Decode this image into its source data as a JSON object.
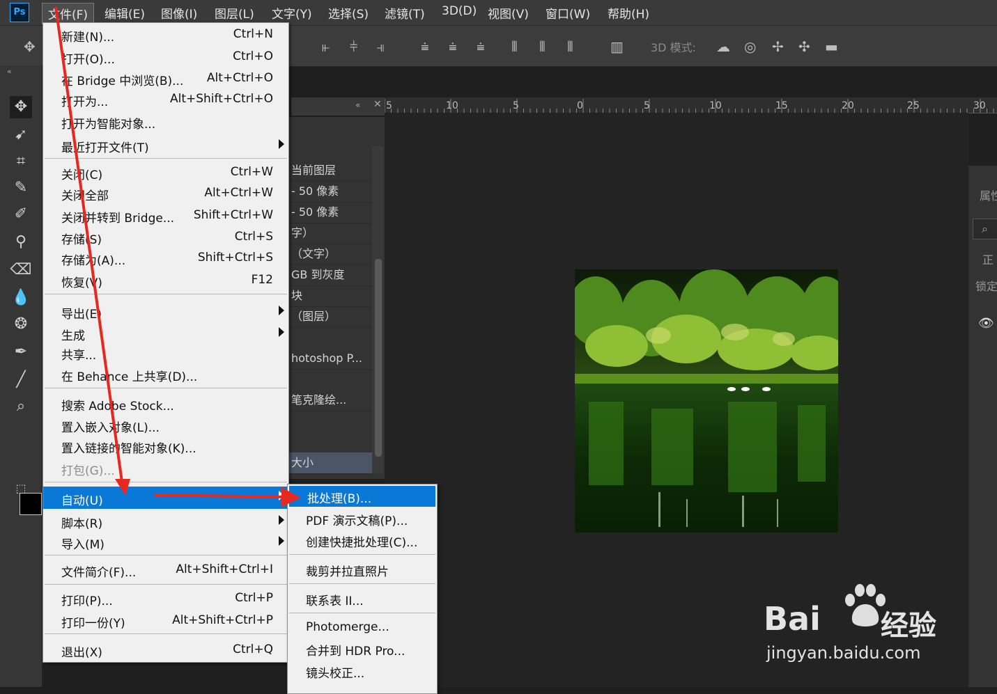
{
  "app": {
    "logo": "Ps"
  },
  "menubar": [
    "文件(F)",
    "编辑(E)",
    "图像(I)",
    "图层(L)",
    "文字(Y)",
    "选择(S)",
    "滤镜(T)",
    "3D(D)",
    "视图(V)",
    "窗口(W)",
    "帮助(H)"
  ],
  "options_bar": {
    "mode_3d_label": "3D 模式:"
  },
  "history_rows": [
    "当前图层",
    "- 50 像素",
    "- 50 像素",
    "字）",
    "（文字）",
    "GB 到灰度",
    "块",
    "（图层）",
    "hotoshop P...",
    "笔克隆绘...",
    "大小"
  ],
  "ruler_ticks": [
    "5",
    "10",
    "5",
    "0",
    "5",
    "10",
    "15",
    "20",
    "25",
    "30"
  ],
  "right_panel": {
    "props": "属性",
    "mode": "正",
    "lock": "锁定"
  },
  "file_menu": {
    "new": {
      "label": "新建(N)...",
      "shortcut": "Ctrl+N"
    },
    "open": {
      "label": "打开(O)...",
      "shortcut": "Ctrl+O"
    },
    "bridge": {
      "label": "在 Bridge 中浏览(B)...",
      "shortcut": "Alt+Ctrl+O"
    },
    "open_as": {
      "label": "打开为...",
      "shortcut": "Alt+Shift+Ctrl+O"
    },
    "open_smart": {
      "label": "打开为智能对象..."
    },
    "recent": {
      "label": "最近打开文件(T)"
    },
    "close": {
      "label": "关闭(C)",
      "shortcut": "Ctrl+W"
    },
    "close_all": {
      "label": "关闭全部",
      "shortcut": "Alt+Ctrl+W"
    },
    "close_bridge": {
      "label": "关闭并转到 Bridge...",
      "shortcut": "Shift+Ctrl+W"
    },
    "save": {
      "label": "存储(S)",
      "shortcut": "Ctrl+S"
    },
    "save_as": {
      "label": "存储为(A)...",
      "shortcut": "Shift+Ctrl+S"
    },
    "revert": {
      "label": "恢复(V)",
      "shortcut": "F12"
    },
    "export": {
      "label": "导出(E)"
    },
    "generate": {
      "label": "生成"
    },
    "share": {
      "label": "共享..."
    },
    "behance": {
      "label": "在 Behance 上共享(D)..."
    },
    "stock": {
      "label": "搜索 Adobe Stock..."
    },
    "place_embed": {
      "label": "置入嵌入对象(L)..."
    },
    "place_linked": {
      "label": "置入链接的智能对象(K)..."
    },
    "package": {
      "label": "打包(G)..."
    },
    "automate": {
      "label": "自动(U)"
    },
    "scripts": {
      "label": "脚本(R)"
    },
    "import": {
      "label": "导入(M)"
    },
    "file_info": {
      "label": "文件简介(F)...",
      "shortcut": "Alt+Shift+Ctrl+I"
    },
    "print": {
      "label": "打印(P)...",
      "shortcut": "Ctrl+P"
    },
    "print_one": {
      "label": "打印一份(Y)",
      "shortcut": "Alt+Shift+Ctrl+P"
    },
    "exit": {
      "label": "退出(X)",
      "shortcut": "Ctrl+Q"
    }
  },
  "automate_menu": [
    "批处理(B)...",
    "PDF 演示文稿(P)...",
    "创建快捷批处理(C)...",
    "裁剪并拉直照片",
    "联系表 II...",
    "Photomerge...",
    "合并到 HDR Pro...",
    "镜头校正..."
  ],
  "watermark": {
    "brand": "Bai",
    "brand_suffix": "经验",
    "url": "jingyan.baidu.com"
  },
  "colors": {
    "highlight": "#0a78d7",
    "annotation_arrow": "#e8281e"
  }
}
